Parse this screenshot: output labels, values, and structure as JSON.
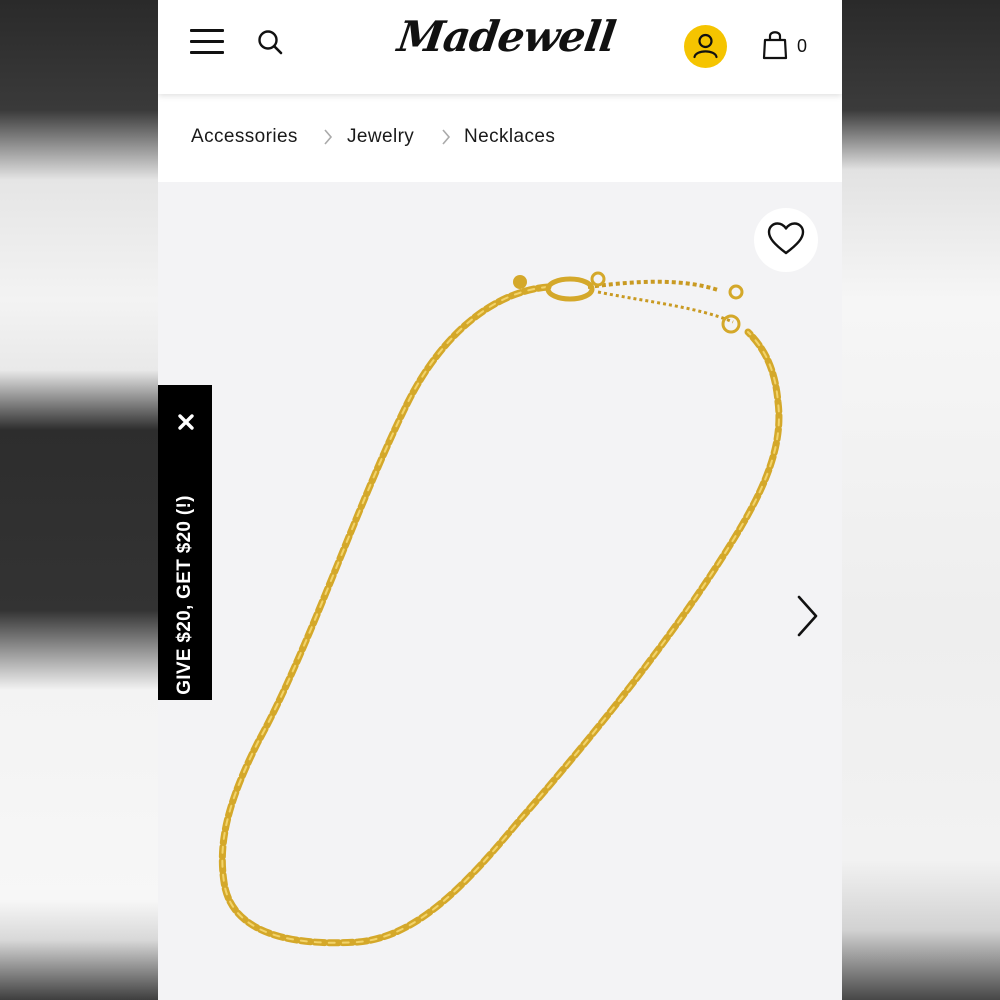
{
  "header": {
    "logo_text": "Madewell",
    "bag_count": "0",
    "account_color": "#f5c400"
  },
  "breadcrumb": {
    "items": [
      "Accessories",
      "Jewelry",
      "Necklaces"
    ]
  },
  "promo": {
    "text": "GIVE $20, GET $20 (!)"
  },
  "icons": {
    "menu": "hamburger-menu-icon",
    "search": "search-icon",
    "account": "user-icon",
    "bag": "shopping-bag-icon",
    "wishlist": "heart-icon",
    "next": "chevron-right-icon",
    "close": "close-icon"
  },
  "colors": {
    "accent_yellow": "#f5c400",
    "gold_chain": "#d4a82a"
  }
}
